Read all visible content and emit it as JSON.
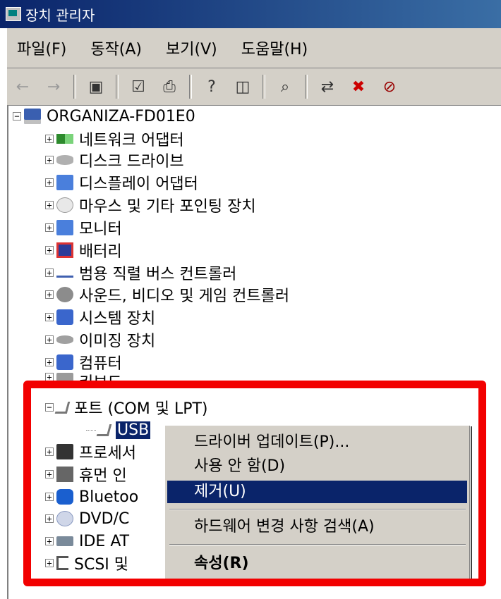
{
  "window": {
    "title": "장치 관리자"
  },
  "menu": [
    "파일(F)",
    "동작(A)",
    "보기(V)",
    "도움말(H)"
  ],
  "toolbar_icons": [
    "back-icon",
    "forward-icon",
    "show-hide-tree-icon",
    "properties-icon",
    "print-icon",
    "help-icon",
    "view-icon",
    "scan-hardware-icon",
    "update-driver-icon",
    "uninstall-icon",
    "disable-icon"
  ],
  "tree": {
    "root": "ORGANIZA-FD01E0",
    "items": [
      {
        "label": "네트워크 어댑터",
        "icon": "network-adapter-icon"
      },
      {
        "label": "디스크 드라이브",
        "icon": "disk-drive-icon"
      },
      {
        "label": "디스플레이 어댑터",
        "icon": "display-adapter-icon"
      },
      {
        "label": "마우스 및 기타 포인팅 장치",
        "icon": "mouse-icon"
      },
      {
        "label": "모니터",
        "icon": "monitor-icon"
      },
      {
        "label": "배터리",
        "icon": "battery-icon"
      },
      {
        "label": "범용 직렬 버스 컨트롤러",
        "icon": "usb-controller-icon"
      },
      {
        "label": "사운드, 비디오 및 게임 컨트롤러",
        "icon": "sound-icon"
      },
      {
        "label": "시스템 장치",
        "icon": "system-device-icon"
      },
      {
        "label": "이미징 장치",
        "icon": "imaging-device-icon"
      },
      {
        "label": "컴퓨터",
        "icon": "computer-icon"
      },
      {
        "label": "키보드",
        "icon": "keyboard-icon"
      },
      {
        "label": "포트 (COM 및 LPT)",
        "icon": "port-icon"
      },
      {
        "label": "USB",
        "icon": "port-device-icon"
      },
      {
        "label": "프로세서",
        "icon": "processor-icon"
      },
      {
        "label": "휴먼 인",
        "icon": "hid-icon"
      },
      {
        "label": "Bluetoo",
        "icon": "bluetooth-icon"
      },
      {
        "label": "DVD/C",
        "icon": "dvd-icon"
      },
      {
        "label": "IDE AT",
        "icon": "ide-icon"
      },
      {
        "label": "SCSI 및",
        "icon": "scsi-icon"
      }
    ]
  },
  "context_menu": {
    "items": [
      "드라이버 업데이트(P)...",
      "사용 안 함(D)",
      "제거(U)",
      "하드웨어 변경 사항 검색(A)",
      "속성(R)"
    ],
    "highlighted": "제거(U)"
  },
  "colors": {
    "highlight": "#0a246a",
    "annotation_border": "#f20000",
    "chrome": "#d4d0c8"
  }
}
